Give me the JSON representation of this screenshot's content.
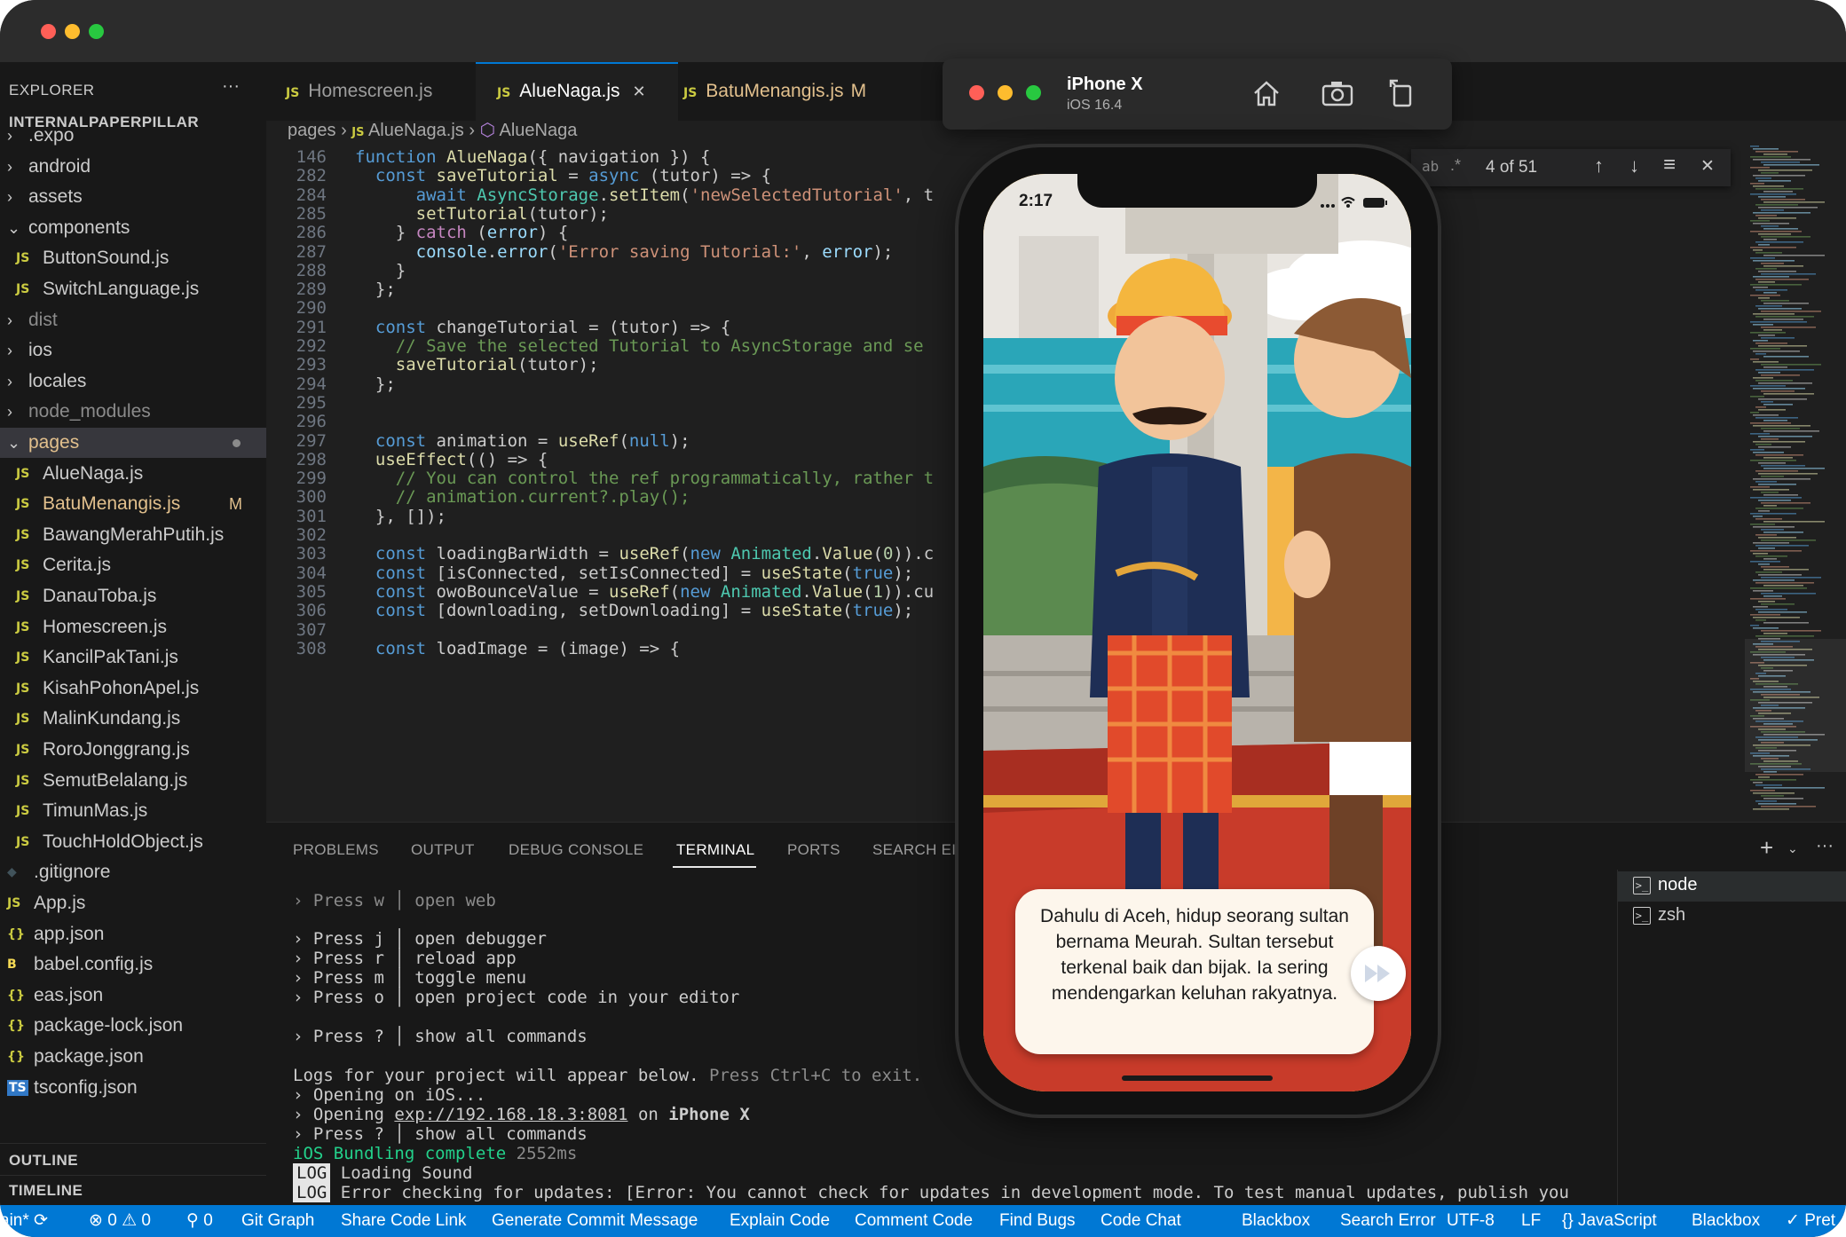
{
  "explorer": {
    "title": "EXPLORER",
    "more": "···",
    "project": "INTERNALPAPERPILLAR",
    "items": [
      {
        "label": ".expo",
        "type": "folder"
      },
      {
        "label": "android",
        "type": "folder"
      },
      {
        "label": "assets",
        "type": "folder"
      },
      {
        "label": "components",
        "type": "folder-open"
      },
      {
        "label": "ButtonSound.js",
        "type": "js"
      },
      {
        "label": "SwitchLanguage.js",
        "type": "js"
      },
      {
        "label": "dist",
        "type": "folder"
      },
      {
        "label": "ios",
        "type": "folder"
      },
      {
        "label": "locales",
        "type": "folder"
      },
      {
        "label": "node_modules",
        "type": "folder"
      },
      {
        "label": "pages",
        "type": "folder-open"
      },
      {
        "label": "AlueNaga.js",
        "type": "js"
      },
      {
        "label": "BatuMenangis.js",
        "type": "js",
        "badge": "M"
      },
      {
        "label": "BawangMerahPutih.js",
        "type": "js"
      },
      {
        "label": "Cerita.js",
        "type": "js"
      },
      {
        "label": "DanauToba.js",
        "type": "js"
      },
      {
        "label": "Homescreen.js",
        "type": "js"
      },
      {
        "label": "KancilPakTani.js",
        "type": "js"
      },
      {
        "label": "KisahPohonApel.js",
        "type": "js"
      },
      {
        "label": "MalinKundang.js",
        "type": "js"
      },
      {
        "label": "RoroJonggrang.js",
        "type": "js"
      },
      {
        "label": "SemutBelalang.js",
        "type": "js"
      },
      {
        "label": "TimunMas.js",
        "type": "js"
      },
      {
        "label": "TouchHoldObject.js",
        "type": "js"
      },
      {
        "label": ".gitignore",
        "type": "git"
      },
      {
        "label": "App.js",
        "type": "js"
      },
      {
        "label": "app.json",
        "type": "json"
      },
      {
        "label": "babel.config.js",
        "type": "babel"
      },
      {
        "label": "eas.json",
        "type": "json"
      },
      {
        "label": "package-lock.json",
        "type": "json"
      },
      {
        "label": "package.json",
        "type": "json"
      },
      {
        "label": "tsconfig.json",
        "type": "ts"
      }
    ],
    "outline": "OUTLINE",
    "timeline": "TIMELINE"
  },
  "tabs": [
    {
      "icon": "JS",
      "label": "Homescreen.js",
      "active": false
    },
    {
      "icon": "JS",
      "label": "AlueNaga.js",
      "active": true,
      "close": "✕"
    },
    {
      "icon": "JS",
      "label": "BatuMenangis.js",
      "active": false,
      "badge": "M"
    }
  ],
  "breadcrumb": {
    "folder": "pages",
    "file": "AlueNaga.js",
    "symbol": "AlueNaga"
  },
  "find": {
    "count": "4 of 51"
  },
  "code": [
    {
      "ln": "146",
      "text": "function AlueNaga({ navigation }) {"
    },
    {
      "ln": "282",
      "text": "  const saveTutorial = async (tutor) => {"
    },
    {
      "ln": "284",
      "text": "      await AsyncStorage.setItem('newSelectedTutorial', t"
    },
    {
      "ln": "285",
      "text": "      setTutorial(tutor);"
    },
    {
      "ln": "286",
      "text": "    } catch (error) {"
    },
    {
      "ln": "287",
      "text": "      console.error('Error saving Tutorial:', error);"
    },
    {
      "ln": "288",
      "text": "    }"
    },
    {
      "ln": "289",
      "text": "  };"
    },
    {
      "ln": "290",
      "text": ""
    },
    {
      "ln": "291",
      "text": "  const changeTutorial = (tutor) => {"
    },
    {
      "ln": "292",
      "text": "    // Save the selected Tutorial to AsyncStorage and se"
    },
    {
      "ln": "293",
      "text": "    saveTutorial(tutor);"
    },
    {
      "ln": "294",
      "text": "  };"
    },
    {
      "ln": "295",
      "text": ""
    },
    {
      "ln": "296",
      "text": ""
    },
    {
      "ln": "297",
      "text": "  const animation = useRef(null);"
    },
    {
      "ln": "298",
      "text": "  useEffect(() => {"
    },
    {
      "ln": "299",
      "text": "    // You can control the ref programmatically, rather t"
    },
    {
      "ln": "300",
      "text": "    // animation.current?.play();"
    },
    {
      "ln": "301",
      "text": "  }, []);"
    },
    {
      "ln": "302",
      "text": ""
    },
    {
      "ln": "303",
      "text": "  const loadingBarWidth = useRef(new Animated.Value(0)).c"
    },
    {
      "ln": "304",
      "text": "  const [isConnected, setIsConnected] = useState(true);"
    },
    {
      "ln": "305",
      "text": "  const owoBounceValue = useRef(new Animated.Value(1)).cu"
    },
    {
      "ln": "306",
      "text": "  const [downloading, setDownloading] = useState(true);"
    },
    {
      "ln": "307",
      "text": ""
    },
    {
      "ln": "308",
      "text": "  const loadImage = (image) => {"
    }
  ],
  "panel": {
    "tabs": [
      "PROBLEMS",
      "OUTPUT",
      "DEBUG CONSOLE",
      "TERMINAL",
      "PORTS",
      "SEARCH EI"
    ],
    "active": "TERMINAL",
    "terminals": [
      "node",
      "zsh"
    ]
  },
  "terminal": {
    "press_w": "› Press w │ open web",
    "press_j": "› Press j │ open debugger",
    "press_r": "› Press r │ reload app",
    "press_m": "› Press m │ toggle menu",
    "press_o": "› Press o │ open project code in your editor",
    "press_q": "› Press ? │ show all commands",
    "logs_a": "Logs for your project will appear below.",
    "logs_b": " Press Ctrl+C to exit.",
    "opening_ios": "› Opening on iOS...",
    "opening_exp_a": "› Opening ",
    "opening_exp_link": "exp://192.168.18.3:8081",
    "opening_exp_b": " on ",
    "opening_exp_dev": "iPhone X",
    "press_q2": "› Press ? │ show all commands",
    "bundling_a": "iOS Bundling complete",
    "bundling_b": " 2552ms",
    "log_badge": "LOG",
    "log1": " Loading Sound",
    "log2": " Error checking for updates: [Error: You cannot check for updates in development mode. To test manual updates, publish you"
  },
  "simulator": {
    "device": "iPhone X",
    "os": "iOS 16.4",
    "time": "2:17",
    "story_text": "Dahulu di Aceh, hidup seorang sultan bernama Meurah. Sultan tersebut terkenal baik dan bijak. Ia sering mendengarkan keluhan rakyatnya."
  },
  "status": {
    "branch": "ain*",
    "errors": "0",
    "warnings": "0",
    "ports": "0",
    "items": [
      "Git Graph",
      "Share Code Link",
      "Generate Commit Message",
      "Explain Code",
      "Comment Code",
      "Find Bugs",
      "Code Chat",
      "Blackbox",
      "Search Error"
    ],
    "encoding": "UTF-8",
    "eol": "LF",
    "language": "JavaScript",
    "blackbox": "Blackbox",
    "prettier": "✓ Pret"
  },
  "colors": {
    "accent": "#0078d4",
    "modified": "#e2c08d",
    "js": "#cbcb41"
  }
}
